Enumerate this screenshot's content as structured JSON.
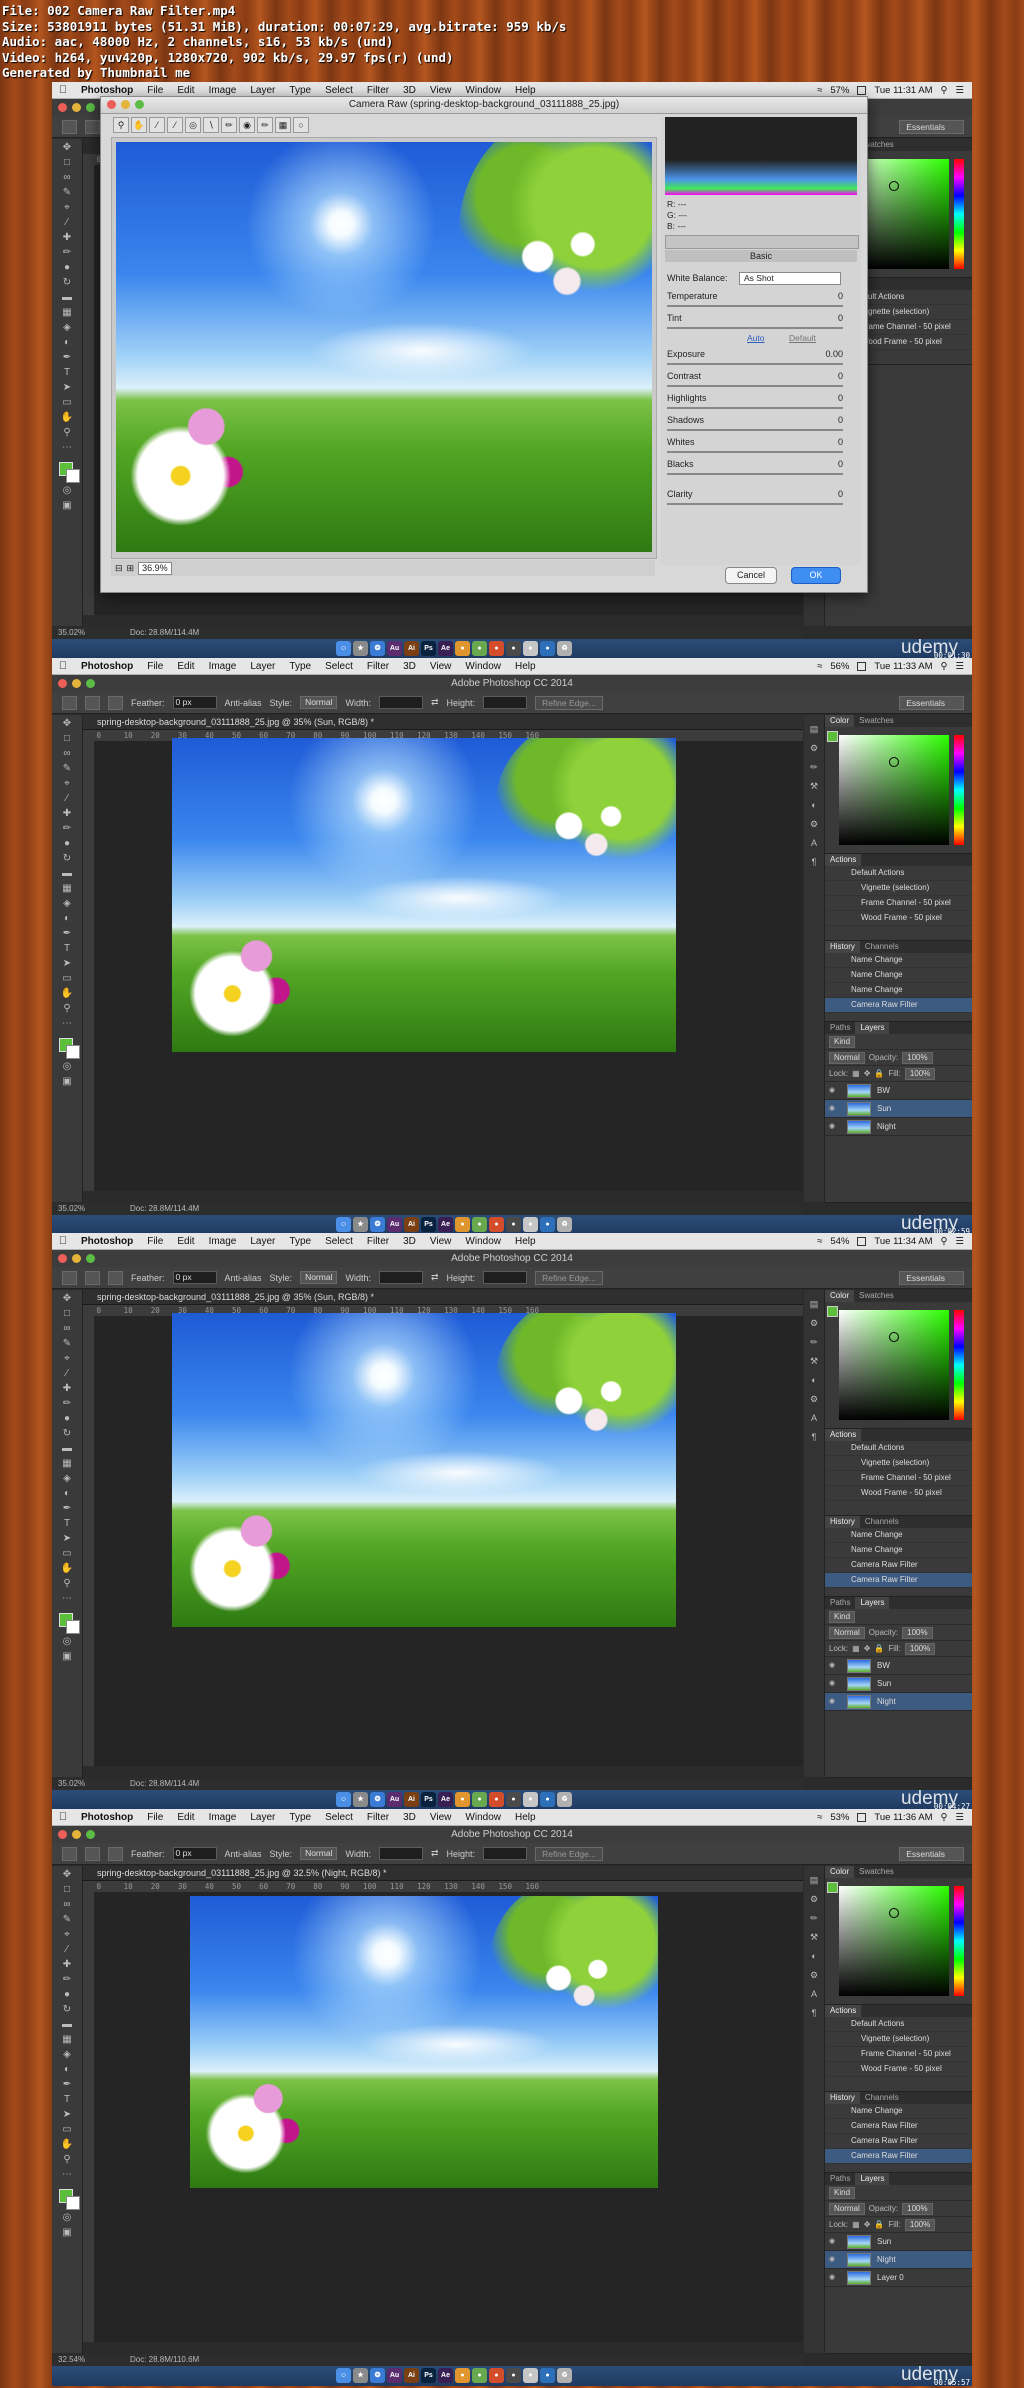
{
  "header": {
    "lines": [
      "File: 002 Camera Raw Filter.mp4",
      "Size: 53801911 bytes (51.31 MiB), duration: 00:07:29, avg.bitrate: 959 kb/s",
      "Audio: aac, 48000 Hz, 2 channels, s16, 53 kb/s (und)",
      "Video: h264, yuv420p, 1280x720, 902 kb/s, 29.97 fps(r) (und)",
      "Generated by Thumbnail me"
    ]
  },
  "menubar": {
    "app": "Photoshop",
    "items": [
      "File",
      "Edit",
      "Image",
      "Layer",
      "Type",
      "Select",
      "Filter",
      "3D",
      "View",
      "Window",
      "Help"
    ]
  },
  "app_title": "Adobe Photoshop CC 2014",
  "options": {
    "feather_label": "Feather:",
    "feather_value": "0 px",
    "antialias": "Anti-alias",
    "style_label": "Style:",
    "style_value": "Normal",
    "width_label": "Width:",
    "height_label": "Height:",
    "refine": "Refine Edge...",
    "essentials": "Essentials"
  },
  "panels": {
    "color_tabs": [
      "Color",
      "Swatches"
    ],
    "actions_tab": "Actions",
    "actions": [
      "Default Actions",
      "Vignette (selection)",
      "Frame Channel - 50 pixel",
      "Wood Frame - 50 pixel"
    ],
    "history_tabs": [
      "History",
      "Channels"
    ],
    "layers_tabs": [
      "Paths",
      "Layers"
    ],
    "kind": "Kind",
    "blend": "Normal",
    "opacity_label": "Opacity:",
    "opacity": "100%",
    "lock_label": "Lock:",
    "fill_label": "Fill:",
    "fill": "100%"
  },
  "dock_udemy": "udemy",
  "frames": [
    {
      "clock": "Tue 11:31 AM",
      "battery": "57%",
      "zoom": "35.02%",
      "doc": "Doc: 28.8M/114.4M",
      "timestamp": "00:01:30"
    },
    {
      "clock": "Tue 11:33 AM",
      "battery": "56%",
      "zoom": "35.02%",
      "doc": "Doc: 28.8M/114.4M",
      "timestamp": "00:02:59",
      "doctab": "spring-desktop-background_03111888_25.jpg @ 35% (Sun, RGB/8) *",
      "history": [
        "Name Change",
        "Name Change",
        "Name Change",
        "Camera Raw Filter"
      ],
      "layers": [
        "BW",
        "Sun",
        "Night"
      ],
      "selected_layer": 1
    },
    {
      "clock": "Tue 11:34 AM",
      "battery": "54%",
      "zoom": "35.02%",
      "doc": "Doc: 28.8M/114.4M",
      "timestamp": "00:04:27",
      "doctab": "spring-desktop-background_03111888_25.jpg @ 35% (Sun, RGB/8) *",
      "history": [
        "Name Change",
        "Name Change",
        "Camera Raw Filter",
        "Camera Raw Filter"
      ],
      "layers": [
        "BW",
        "Sun",
        "Night"
      ],
      "selected_layer": 2
    },
    {
      "clock": "Tue 11:36 AM",
      "battery": "53%",
      "zoom": "32.54%",
      "doc": "Doc: 28.8M/110.6M",
      "timestamp": "00:05:57",
      "doctab": "spring-desktop-background_03111888_25.jpg @ 32.5% (Night, RGB/8) *",
      "history": [
        "Name Change",
        "Camera Raw Filter",
        "Camera Raw Filter",
        "Camera Raw Filter"
      ],
      "layers": [
        "Sun",
        "Night",
        "Layer 0"
      ],
      "selected_layer": 1
    }
  ],
  "camera_raw": {
    "title": "Camera Raw (spring-desktop-background_03111888_25.jpg)",
    "rgb": [
      "R:  ---",
      "G:  ---",
      "B:  ---"
    ],
    "section": "Basic",
    "white_balance_label": "White Balance:",
    "white_balance_value": "As Shot",
    "rows": [
      {
        "label": "Temperature",
        "value": "0"
      },
      {
        "label": "Tint",
        "value": "0"
      },
      {
        "label": "Exposure",
        "value": "0.00"
      },
      {
        "label": "Contrast",
        "value": "0"
      },
      {
        "label": "Highlights",
        "value": "0"
      },
      {
        "label": "Shadows",
        "value": "0"
      },
      {
        "label": "Whites",
        "value": "0"
      },
      {
        "label": "Blacks",
        "value": "0"
      },
      {
        "label": "Clarity",
        "value": "0"
      }
    ],
    "auto": "Auto",
    "default": "Default",
    "zoom": "36.9%",
    "cancel": "Cancel",
    "ok": "OK"
  }
}
